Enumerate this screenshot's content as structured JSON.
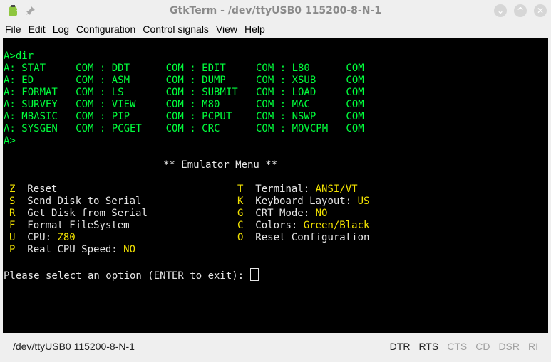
{
  "window": {
    "title": "GtkTerm - /dev/ttyUSB0  115200-8-N-1",
    "close_label": "✕",
    "maximize_label": "^",
    "minimize_label": "⌄"
  },
  "menu": [
    "File",
    "Edit",
    "Log",
    "Configuration",
    "Control signals",
    "View",
    "Help"
  ],
  "terminal": {
    "prompt_cmd": "A>dir",
    "dir_rows": [
      "A: STAT     COM : DDT      COM : EDIT     COM : L80      COM",
      "A: ED       COM : ASM      COM : DUMP     COM : XSUB     COM",
      "A: FORMAT   COM : LS       COM : SUBMIT   COM : LOAD     COM",
      "A: SURVEY   COM : VIEW     COM : M80      COM : MAC      COM",
      "A: MBASIC   COM : PIP      COM : PCPUT    COM : NSWP     COM",
      "A: SYSGEN   COM : PCGET    COM : CRC      COM : MOVCPM   COM"
    ],
    "prompt_end": "A>",
    "menu_title": "** Emulator Menu **",
    "left_options": [
      {
        "key": "Z",
        "label": "Reset",
        "value": ""
      },
      {
        "key": "S",
        "label": "Send Disk to Serial",
        "value": ""
      },
      {
        "key": "R",
        "label": "Get Disk from Serial",
        "value": ""
      },
      {
        "key": "F",
        "label": "Format FileSystem",
        "value": ""
      },
      {
        "key": "U",
        "label": "CPU: ",
        "value": "Z80"
      },
      {
        "key": "P",
        "label": "Real CPU Speed: ",
        "value": "NO"
      }
    ],
    "right_options": [
      {
        "key": "T",
        "label": "Terminal: ",
        "value": "ANSI/VT"
      },
      {
        "key": "K",
        "label": "Keyboard Layout: ",
        "value": "US"
      },
      {
        "key": "G",
        "label": "CRT Mode: ",
        "value": "NO"
      },
      {
        "key": "C",
        "label": "Colors: ",
        "value": "Green/Black"
      },
      {
        "key": "O",
        "label": "Reset Configuration",
        "value": ""
      }
    ],
    "select_prompt": "Please select an option (ENTER to exit): "
  },
  "status": {
    "port": "/dev/ttyUSB0  115200-8-N-1",
    "signals": [
      {
        "name": "DTR",
        "active": true
      },
      {
        "name": "RTS",
        "active": true
      },
      {
        "name": "CTS",
        "active": false
      },
      {
        "name": "CD",
        "active": false
      },
      {
        "name": "DSR",
        "active": false
      },
      {
        "name": "RI",
        "active": false
      }
    ]
  },
  "colors": {
    "terminal_bg": "#000000",
    "terminal_fg": "#00ff3c",
    "menu_key": "#f2e200",
    "menu_text": "#e6e6e6"
  }
}
